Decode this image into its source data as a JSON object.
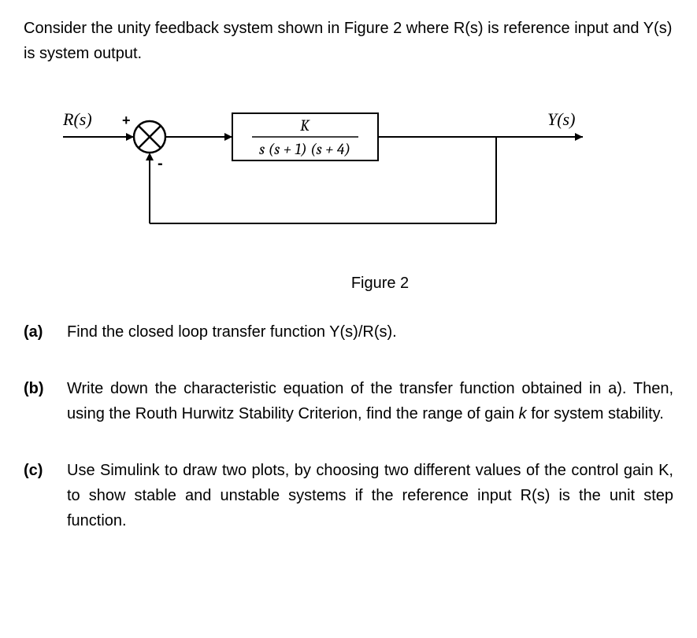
{
  "intro": "Consider the unity feedback system shown in Figure 2 where R(s) is reference input and Y(s) is system output.",
  "diagram": {
    "input_label": "R(s)",
    "output_label": "Y(s)",
    "plus_sign": "+",
    "minus_sign": "-",
    "tf_numerator": "K",
    "tf_denominator": "s (s + 1) (s + 4)"
  },
  "figure_caption": "Figure 2",
  "questions": {
    "a": {
      "label": "(a)",
      "text": "Find the closed loop transfer function Y(s)/R(s)."
    },
    "b": {
      "label": "(b)",
      "text_part1": "Write down the characteristic equation of the transfer function obtained in a). Then, using the Routh Hurwitz Stability Criterion, find the range of gain ",
      "text_italic": "k",
      "text_part2": " for system stability."
    },
    "c": {
      "label": "(c)",
      "text": "Use Simulink to draw two plots, by choosing two different values of the control gain K, to show stable and unstable systems if the reference input R(s) is the unit step function."
    }
  }
}
